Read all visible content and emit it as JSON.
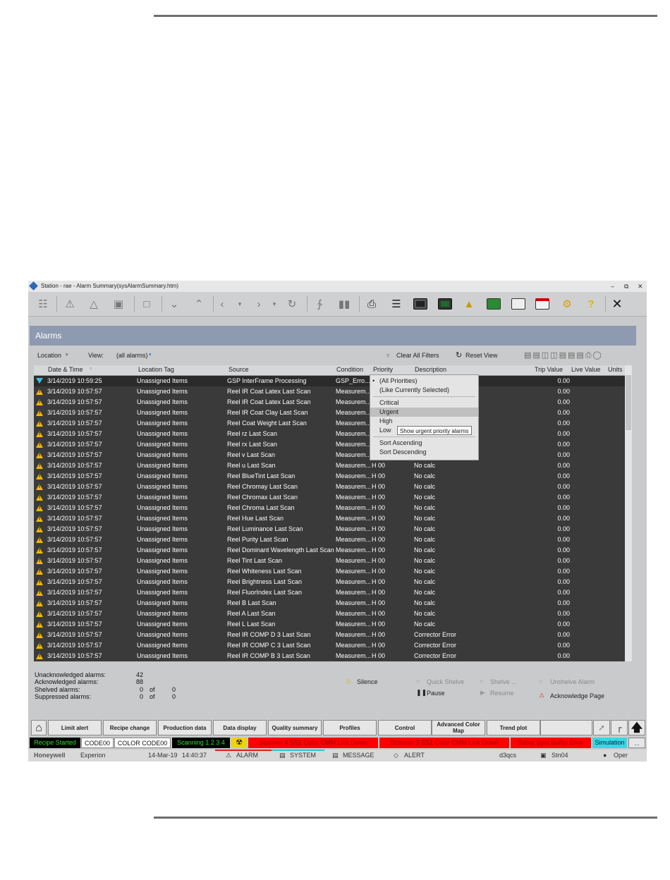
{
  "window": {
    "title": "Station - rae - Alarm Summary(sysAlarmSummary.htm)",
    "min": "–",
    "restore": "⧉",
    "close": "✕"
  },
  "toolbar": {
    "close_glyph": "✕"
  },
  "banner": {
    "title": "Alarms"
  },
  "filters": {
    "location": "Location",
    "view_label": "View:",
    "view_value": "(all alarms)",
    "clear": "Clear All Filters",
    "reset": "Reset View"
  },
  "columns": {
    "date": "Date & Time",
    "location": "Location Tag",
    "source": "Source",
    "condition": "Condition",
    "priority": "Priority",
    "description": "Description",
    "trip": "Trip Value",
    "live": "Live Value",
    "units": "Units"
  },
  "rows": [
    {
      "icon": "diamond-down",
      "date": "3/14/2019 10:59:25",
      "loc": "Unassigned Items",
      "src": "GSP InterFrame Processing",
      "cond": "GSP_Erro...",
      "pri": "",
      "desc": "",
      "trip": "0.00"
    },
    {
      "icon": "warning",
      "date": "3/14/2019 10:57:57",
      "loc": "Unassigned Items",
      "src": "Reel IR Coat Latex Last Scan",
      "cond": "Measurem...",
      "pri": "",
      "desc": "",
      "trip": "0.00"
    },
    {
      "icon": "warning",
      "date": "3/14/2019 10:57:57",
      "loc": "Unassigned Items",
      "src": "Reel IR Coat Latex Last Scan",
      "cond": "Measurem...",
      "pri": "",
      "desc": "",
      "trip": "0.00"
    },
    {
      "icon": "warning",
      "date": "3/14/2019 10:57:57",
      "loc": "Unassigned Items",
      "src": "Reel IR Coat Clay Last Scan",
      "cond": "Measurem...",
      "pri": "",
      "desc": "",
      "trip": "0.00"
    },
    {
      "icon": "warning",
      "date": "3/14/2019 10:57:57",
      "loc": "Unassigned Items",
      "src": "Reel Coat Weight Last Scan",
      "cond": "Measurem...",
      "pri": "",
      "desc": "",
      "trip": "0.00"
    },
    {
      "icon": "warning",
      "date": "3/14/2019 10:57:57",
      "loc": "Unassigned Items",
      "src": "Reel rz Last Scan",
      "cond": "Measurem...",
      "pri": "",
      "desc": "",
      "trip": "0.00"
    },
    {
      "icon": "warning",
      "date": "3/14/2019 10:57:57",
      "loc": "Unassigned Items",
      "src": "Reel rx Last Scan",
      "cond": "Measurem...",
      "pri": "",
      "desc": "",
      "trip": "0.00"
    },
    {
      "icon": "warning",
      "date": "3/14/2019 10:57:57",
      "loc": "Unassigned Items",
      "src": "Reel v Last Scan",
      "cond": "Measurem...",
      "pri": "",
      "desc": "",
      "trip": "0.00"
    },
    {
      "icon": "warning",
      "date": "3/14/2019 10:57:57",
      "loc": "Unassigned Items",
      "src": "Reel u Last Scan",
      "cond": "Measurem...",
      "pri": "H 00",
      "desc": "No calc",
      "trip": "0.00"
    },
    {
      "icon": "warning",
      "date": "3/14/2019 10:57:57",
      "loc": "Unassigned Items",
      "src": "Reel BlueTint Last Scan",
      "cond": "Measurem...",
      "pri": "H 00",
      "desc": "No calc",
      "trip": "0.00"
    },
    {
      "icon": "warning",
      "date": "3/14/2019 10:57:57",
      "loc": "Unassigned Items",
      "src": "Reel Chromay Last Scan",
      "cond": "Measurem...",
      "pri": "H 00",
      "desc": "No calc",
      "trip": "0.00"
    },
    {
      "icon": "warning",
      "date": "3/14/2019 10:57:57",
      "loc": "Unassigned Items",
      "src": "Reel Chromax Last Scan",
      "cond": "Measurem...",
      "pri": "H 00",
      "desc": "No calc",
      "trip": "0.00"
    },
    {
      "icon": "warning",
      "date": "3/14/2019 10:57:57",
      "loc": "Unassigned Items",
      "src": "Reel Chroma Last Scan",
      "cond": "Measurem...",
      "pri": "H 00",
      "desc": "No calc",
      "trip": "0.00"
    },
    {
      "icon": "warning",
      "date": "3/14/2019 10:57:57",
      "loc": "Unassigned Items",
      "src": "Reel Hue Last Scan",
      "cond": "Measurem...",
      "pri": "H 00",
      "desc": "No calc",
      "trip": "0.00"
    },
    {
      "icon": "warning",
      "date": "3/14/2019 10:57:57",
      "loc": "Unassigned Items",
      "src": "Reel Luminance Last Scan",
      "cond": "Measurem...",
      "pri": "H 00",
      "desc": "No calc",
      "trip": "0.00"
    },
    {
      "icon": "warning",
      "date": "3/14/2019 10:57:57",
      "loc": "Unassigned Items",
      "src": "Reel Purity Last Scan",
      "cond": "Measurem...",
      "pri": "H 00",
      "desc": "No calc",
      "trip": "0.00"
    },
    {
      "icon": "warning",
      "date": "3/14/2019 10:57:57",
      "loc": "Unassigned Items",
      "src": "Reel Dominant Wavelength Last Scan",
      "cond": "Measurem...",
      "pri": "H 00",
      "desc": "No calc",
      "trip": "0.00"
    },
    {
      "icon": "warning",
      "date": "3/14/2019 10:57:57",
      "loc": "Unassigned Items",
      "src": "Reel Tint Last Scan",
      "cond": "Measurem...",
      "pri": "H 00",
      "desc": "No calc",
      "trip": "0.00"
    },
    {
      "icon": "warning",
      "date": "3/14/2019 10:57:57",
      "loc": "Unassigned Items",
      "src": "Reel Whiteness Last Scan",
      "cond": "Measurem...",
      "pri": "H 00",
      "desc": "No calc",
      "trip": "0.00"
    },
    {
      "icon": "warning",
      "date": "3/14/2019 10:57:57",
      "loc": "Unassigned Items",
      "src": "Reel Brightness Last Scan",
      "cond": "Measurem...",
      "pri": "H 00",
      "desc": "No calc",
      "trip": "0.00"
    },
    {
      "icon": "warning",
      "date": "3/14/2019 10:57:57",
      "loc": "Unassigned Items",
      "src": "Reel FluorIndex Last Scan",
      "cond": "Measurem...",
      "pri": "H 00",
      "desc": "No calc",
      "trip": "0.00"
    },
    {
      "icon": "warning",
      "date": "3/14/2019 10:57:57",
      "loc": "Unassigned Items",
      "src": "Reel B Last Scan",
      "cond": "Measurem...",
      "pri": "H 00",
      "desc": "No calc",
      "trip": "0.00"
    },
    {
      "icon": "warning",
      "date": "3/14/2019 10:57:57",
      "loc": "Unassigned Items",
      "src": "Reel A Last Scan",
      "cond": "Measurem...",
      "pri": "H 00",
      "desc": "No calc",
      "trip": "0.00"
    },
    {
      "icon": "warning",
      "date": "3/14/2019 10:57:57",
      "loc": "Unassigned Items",
      "src": "Reel L Last Scan",
      "cond": "Measurem...",
      "pri": "H 00",
      "desc": "No calc",
      "trip": "0.00"
    },
    {
      "icon": "warning",
      "date": "3/14/2019 10:57:57",
      "loc": "Unassigned Items",
      "src": "Reel IR COMP D 3 Last Scan",
      "cond": "Measurem...",
      "pri": "H 00",
      "desc": "Corrector Error",
      "trip": "0.00"
    },
    {
      "icon": "warning",
      "date": "3/14/2019 10:57:57",
      "loc": "Unassigned Items",
      "src": "Reel IR COMP C 3 Last Scan",
      "cond": "Measurem...",
      "pri": "H 00",
      "desc": "Corrector Error",
      "trip": "0.00"
    },
    {
      "icon": "warning",
      "date": "3/14/2019 10:57:57",
      "loc": "Unassigned Items",
      "src": "Reel IR COMP B 3 Last Scan",
      "cond": "Measurem...",
      "pri": "H 00",
      "desc": "Corrector Error",
      "trip": "0.00"
    }
  ],
  "priority_menu": {
    "items": [
      "(All Priorities)",
      "(Like Currently Selected)",
      "Critical",
      "Urgent",
      "High",
      "Low",
      "Sort Ascending",
      "Sort Descending"
    ],
    "tooltip": "Show urgent priority alarms"
  },
  "counts": {
    "unack_label": "Unacknowledged alarms:",
    "unack_value": "42",
    "ack_label": "Acknowledged alarms:",
    "ack_value": "88",
    "shelved_label": "Shelved alarms:",
    "shelved_value": "0",
    "shelved_of": "of",
    "shelved_total": "0",
    "suppressed_label": "Suppressed alarms:",
    "suppressed_value": "0",
    "suppressed_of": "of",
    "suppressed_total": "0"
  },
  "actions": {
    "silence": "Silence",
    "quick_shelve": "Quick Shelve",
    "shelve": "Shelve ...",
    "unshelve": "Unshelve Alarm",
    "pause": "Pause",
    "resume": "Resume",
    "ack_page": "Acknowledge Page"
  },
  "nav": {
    "limit": "Limit alert",
    "recipe": "Recipe change",
    "production": "Production data",
    "display": "Data display",
    "quality": "Quality summary",
    "profiles": "Profiles",
    "control": "Control",
    "advanced": "Advanced Color Map",
    "trend": "Trend plot"
  },
  "status": {
    "recipe": "Recipe Started",
    "code": "CODE00",
    "color_code": "COLOR CODE00",
    "scanning": "Scanning 1 2 3 4",
    "scanner4": "Scanner 4 SS1 Color CMM Link Down",
    "scanner3": "Scanner 3 SS1 Color CMM Link Down",
    "buffer": "Same Spot Buffer Error",
    "simulation": "Simulation",
    "more": "..."
  },
  "footer": {
    "brand": "Honeywell",
    "product": "Experion",
    "date": "14-Mar-19",
    "time": "14:40:37",
    "alarm": "ALARM",
    "system": "SYSTEM",
    "message": "MESSAGE",
    "alert": "ALERT",
    "server": "d3qcs",
    "station": "Stn04",
    "user": "Oper"
  }
}
